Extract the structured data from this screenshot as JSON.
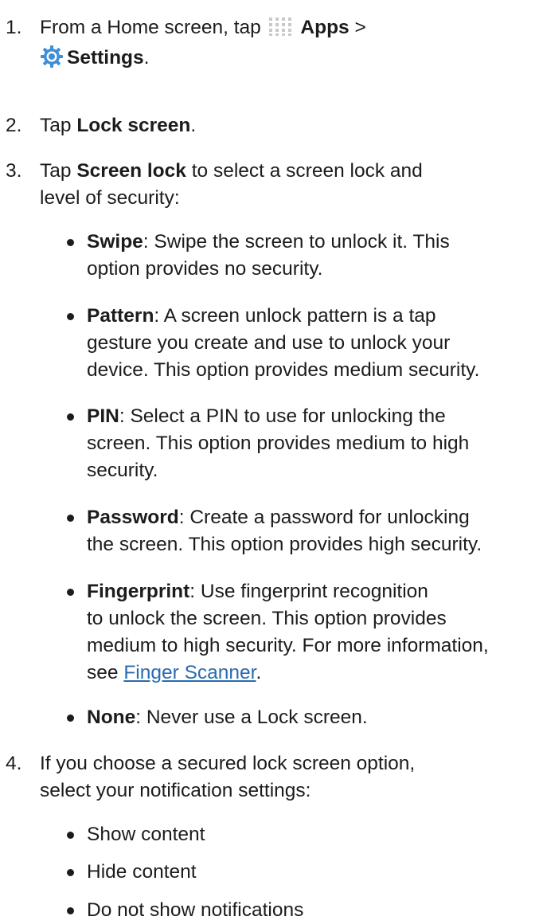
{
  "steps": [
    {
      "number": "1.",
      "pre": "From a Home screen, tap",
      "apps_label": "Apps",
      "sep": ">",
      "settings_label": "Settings",
      "end": "."
    },
    {
      "number": "2.",
      "pre": "Tap",
      "bold": "Lock screen",
      "end": "."
    },
    {
      "number": "3.",
      "pre": "Tap",
      "bold": "Screen lock",
      "line1_rest": "to select a screen lock and",
      "line2": "level of security:",
      "options": [
        {
          "name": "Swipe",
          "lines": [
            ": Swipe the screen to unlock it. This",
            "option provides no security."
          ]
        },
        {
          "name": "Pattern",
          "lines": [
            ": A screen unlock pattern is a tap",
            "gesture you create and use to unlock your",
            "device. This option provides medium security."
          ]
        },
        {
          "name": "PIN",
          "lines": [
            ": Select a PIN to use for unlocking the",
            "screen. This option provides medium to high",
            "security."
          ]
        },
        {
          "name": "Password",
          "lines": [
            ": Create a password for unlocking",
            "the screen. This option provides high security."
          ]
        },
        {
          "name": "Fingerprint",
          "lines": [
            ": Use fingerprint recognition",
            "to unlock the screen. This option provides",
            "medium to high security. For more information,"
          ],
          "see": "see",
          "link": "Finger Scanner",
          "end": "."
        },
        {
          "name": "None",
          "lines": [
            ": Never use a Lock screen."
          ]
        }
      ]
    },
    {
      "number": "4.",
      "lines": [
        "If you choose a secured lock screen option,",
        "select your notification settings:"
      ],
      "options": [
        "Show content",
        "Hide content",
        "Do not show notifications"
      ]
    }
  ],
  "icons": {
    "apps": "apps-grid-icon",
    "settings": "settings-gear-icon"
  },
  "colors": {
    "link": "#2a6cb0",
    "text": "#1c1c1c"
  }
}
